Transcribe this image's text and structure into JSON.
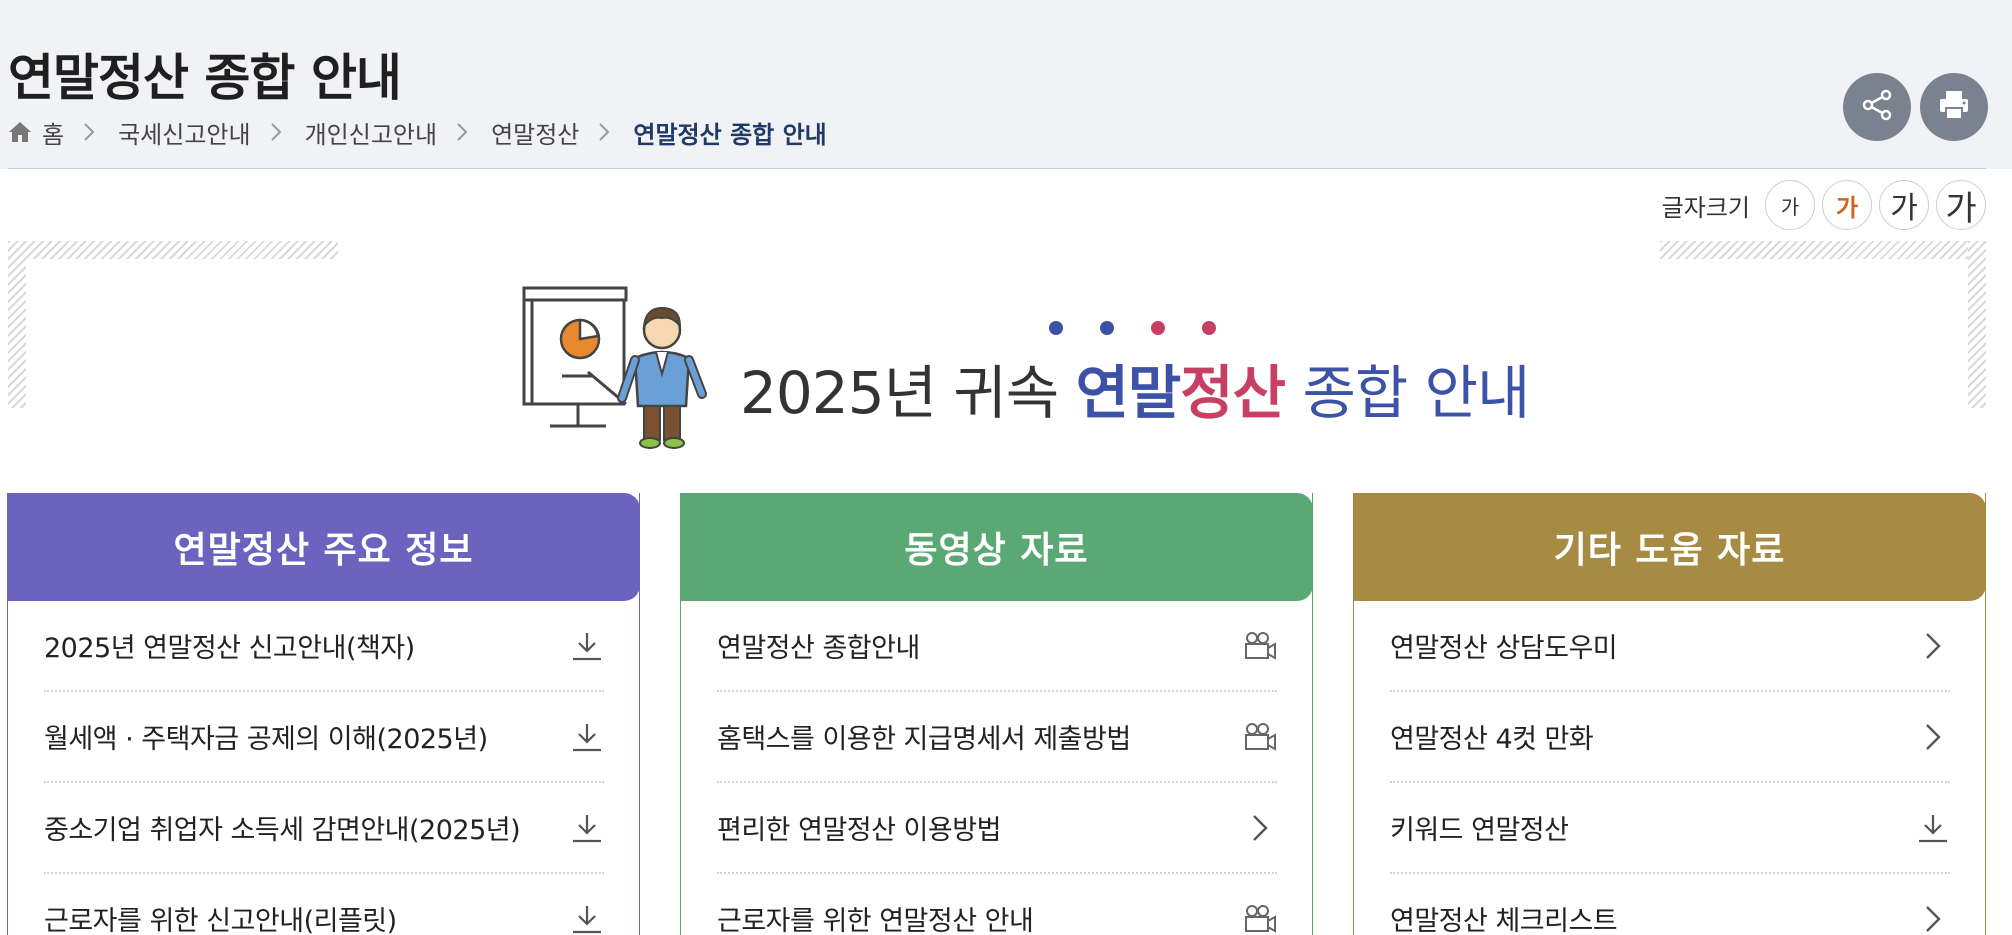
{
  "header": {
    "title": "연말정산 종합 안내",
    "breadcrumb": [
      "홈",
      "국세신고안내",
      "개인신고안내",
      "연말정산"
    ],
    "breadcrumb_current": "연말정산 종합 안내"
  },
  "font_size": {
    "label": "글자크기",
    "options": [
      "가",
      "가",
      "가",
      "가"
    ],
    "selected_index": 1
  },
  "banner": {
    "year": "2025년 귀속",
    "word_a": "연말",
    "word_b": "정산",
    "word_c": "종합 안내"
  },
  "colors": {
    "col1": "#6b63be",
    "col2": "#5aa873",
    "col3": "#a88b43",
    "accent_blue": "#3c52a6",
    "accent_pink": "#c73f63"
  },
  "columns": [
    {
      "title": "연말정산 주요 정보",
      "items": [
        {
          "label": "2025년 연말정산 신고안내(책자)",
          "icon": "download-icon"
        },
        {
          "label": "월세액 · 주택자금 공제의 이해(2025년)",
          "icon": "download-icon"
        },
        {
          "label": "중소기업 취업자 소득세 감면안내(2025년)",
          "icon": "download-icon"
        },
        {
          "label": "근로자를 위한 신고안내(리플릿)",
          "icon": "download-icon"
        }
      ]
    },
    {
      "title": "동영상 자료",
      "items": [
        {
          "label": "연말정산 종합안내",
          "icon": "video-camera-icon"
        },
        {
          "label": "홈택스를 이용한 지급명세서 제출방법",
          "icon": "video-camera-icon"
        },
        {
          "label": "편리한 연말정산 이용방법",
          "icon": "chevron-right-icon"
        },
        {
          "label": "근로자를 위한 연말정산 안내",
          "icon": "video-camera-icon"
        }
      ]
    },
    {
      "title": "기타 도움 자료",
      "items": [
        {
          "label": "연말정산 상담도우미",
          "icon": "chevron-right-icon"
        },
        {
          "label": "연말정산 4컷 만화",
          "icon": "chevron-right-icon"
        },
        {
          "label": "키워드 연말정산",
          "icon": "download-icon"
        },
        {
          "label": "연말정산 체크리스트",
          "icon": "chevron-right-icon"
        }
      ]
    }
  ]
}
